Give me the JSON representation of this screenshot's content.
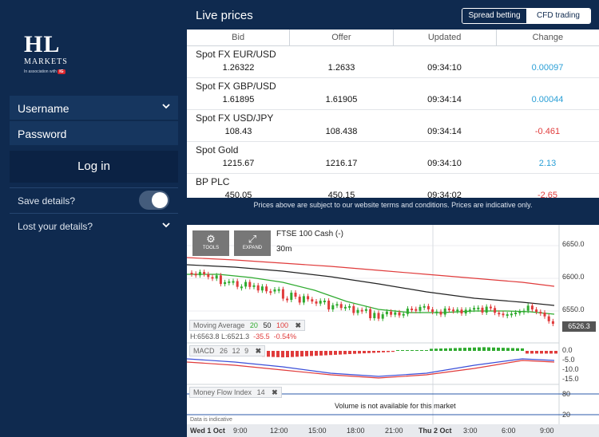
{
  "sidebar": {
    "logo": {
      "line1": "HL",
      "line2": "MARKETS",
      "assoc": "In association with",
      "ig": "IG"
    },
    "username_placeholder": "Username",
    "password_placeholder": "Password",
    "login_label": "Log in",
    "save_details": "Save details?",
    "lost_details": "Lost your details?"
  },
  "header": {
    "title": "Live prices",
    "tabs": [
      "Spread betting",
      "CFD trading"
    ],
    "active_tab": "CFD trading"
  },
  "table": {
    "columns": [
      "Bid",
      "Offer",
      "Updated",
      "Change"
    ],
    "rows": [
      {
        "name": "Spot FX EUR/USD",
        "bid": "1.26322",
        "offer": "1.2633",
        "updated": "09:34:10",
        "change": "0.00097",
        "dir": "pos"
      },
      {
        "name": "Spot FX GBP/USD",
        "bid": "1.61895",
        "offer": "1.61905",
        "updated": "09:34:14",
        "change": "0.00044",
        "dir": "pos"
      },
      {
        "name": "Spot FX USD/JPY",
        "bid": "108.43",
        "offer": "108.438",
        "updated": "09:34:14",
        "change": "-0.461",
        "dir": "neg"
      },
      {
        "name": "Spot Gold",
        "bid": "1215.67",
        "offer": "1216.17",
        "updated": "09:34:10",
        "change": "2.13",
        "dir": "pos"
      },
      {
        "name": "BP PLC",
        "bid": "450.05",
        "offer": "450.15",
        "updated": "09:34:02",
        "change": "-2.65",
        "dir": "neg"
      }
    ]
  },
  "disclaimer": "Prices above are subject to our website terms and conditions. Prices are indicative only.",
  "chart": {
    "tools_label": "TOOLS",
    "expand_label": "EXPAND",
    "instrument": "FTSE 100 Cash (-)",
    "interval": "30m",
    "current_price": "6526.3",
    "moving_average": {
      "label": "Moving Average",
      "p20": "20",
      "p50": "50",
      "p100": "100"
    },
    "stats": {
      "high": "H:6563.8",
      "low": "L:6521.3",
      "chg": "-35.5",
      "pct": "-0.54%"
    },
    "macd": {
      "label": "MACD",
      "p1": "26",
      "p2": "12",
      "p3": "9"
    },
    "mfi": {
      "label": "Money Flow Index",
      "period": "14"
    },
    "volume_note": "Volume is not available for this market",
    "data_note": "Data is indicative",
    "price_ticks": [
      "6650.0",
      "6600.0",
      "6550.0"
    ],
    "macd_ticks": [
      "0.0",
      "-5.0",
      "-10.0",
      "-15.0"
    ],
    "mfi_ticks": [
      "80",
      "20"
    ],
    "time_labels": [
      "Wed 1 Oct",
      "9:00",
      "12:00",
      "15:00",
      "18:00",
      "21:00",
      "Thu 2 Oct",
      "3:00",
      "6:00",
      "9:00"
    ],
    "colors": {
      "ma20": "#2eaa2e",
      "ma50": "#222222",
      "ma100": "#e03b3b",
      "up": "#2eaa2e",
      "down": "#e03b3b"
    }
  }
}
